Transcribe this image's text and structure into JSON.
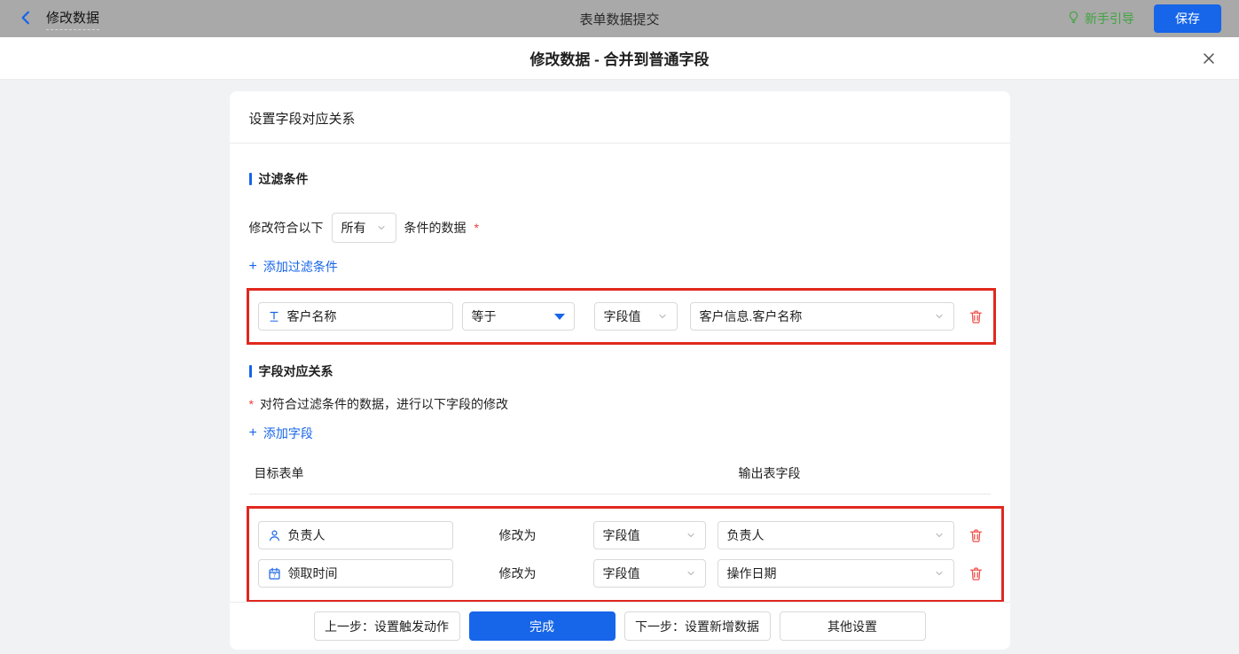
{
  "topbar": {
    "back_label": "修改数据",
    "center_title": "表单数据提交",
    "guide_label": "新手引导",
    "save_label": "保存"
  },
  "modal": {
    "title": "修改数据 - 合并到普通字段"
  },
  "card": {
    "header": "设置字段对应关系",
    "filter": {
      "title": "过滤条件",
      "sentence_prefix": "修改符合以下",
      "match_value": "所有",
      "sentence_suffix": "条件的数据",
      "required_mark": "*",
      "add_label": "添加过滤条件",
      "condition": {
        "field": "客户名称",
        "field_icon": "text-field-icon",
        "operator": "等于",
        "value_type": "字段值",
        "value": "客户信息.客户名称"
      }
    },
    "mapping": {
      "title": "字段对应关系",
      "required_mark": "*",
      "description": "对符合过滤条件的数据，进行以下字段的修改",
      "add_label": "添加字段",
      "col_target": "目标表单",
      "col_output": "输出表字段",
      "modify_label": "修改为",
      "rows": [
        {
          "field": "负责人",
          "field_icon": "user-icon",
          "value_type": "字段值",
          "value": "负责人"
        },
        {
          "field": "领取时间",
          "field_icon": "calendar-icon",
          "value_type": "字段值",
          "value": "操作日期"
        }
      ]
    },
    "footer": {
      "prev_label": "上一步：设置触发动作",
      "done_label": "完成",
      "next_label": "下一步：设置新增数据",
      "other_label": "其他设置"
    }
  },
  "icons": {
    "plus": "+"
  },
  "colors": {
    "accent_blue": "#1765e8",
    "annotation_red": "#e0281e",
    "trash_red": "#f0504a",
    "required_red": "#f23a3a",
    "guide_green": "#3fa43f",
    "topbar_gray": "#a9a9a9",
    "page_bg": "#f1f2f4"
  }
}
